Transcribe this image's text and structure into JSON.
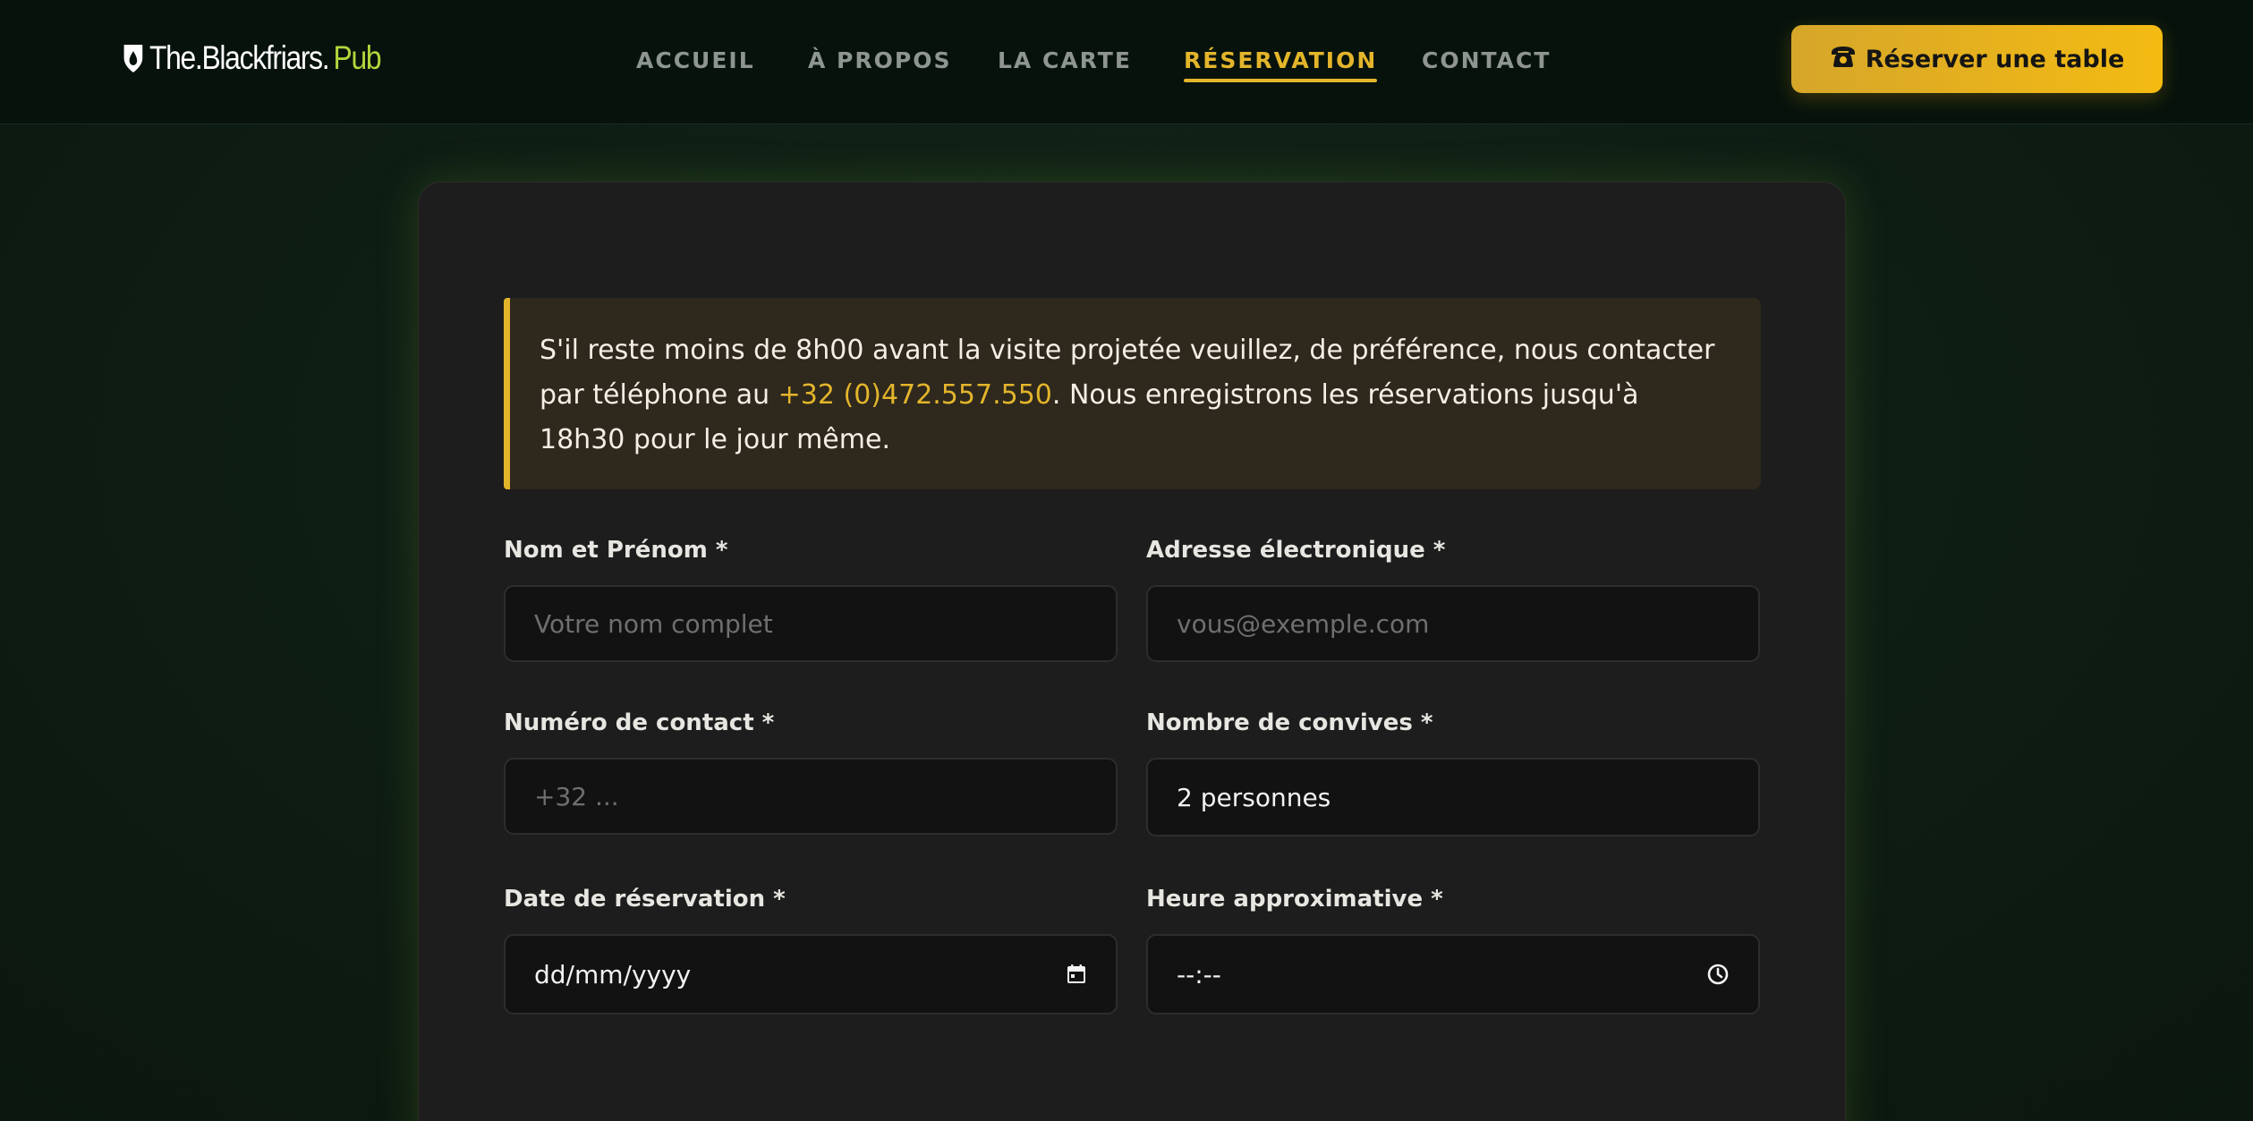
{
  "header": {
    "logo": {
      "main": "The.Blackfriars.",
      "suffix": "Pub"
    },
    "nav": [
      {
        "label": "ACCUEIL",
        "active": false
      },
      {
        "label": "À PROPOS",
        "active": false
      },
      {
        "label": "LA CARTE",
        "active": false
      },
      {
        "label": "RÉSERVATION",
        "active": true
      },
      {
        "label": "CONTACT",
        "active": false
      }
    ],
    "cta": {
      "icon": "phone-icon",
      "label": "Réserver une table"
    }
  },
  "notice": {
    "before": "S'il reste moins de 8h00 avant la visite projetée veuillez, de préférence, nous contacter par téléphone au ",
    "phone": "+32 (0)472.557.550",
    "after": ". Nous enregistrons les réservations jusqu'à 18h30 pour le jour même."
  },
  "form": {
    "name": {
      "label": "Nom et Prénom *",
      "placeholder": "Votre nom complet"
    },
    "email": {
      "label": "Adresse électronique *",
      "placeholder": "vous@exemple.com"
    },
    "phone": {
      "label": "Numéro de contact *",
      "placeholder": "+32 ..."
    },
    "guests": {
      "label": "Nombre de convives *",
      "value": "2 personnes"
    },
    "date": {
      "label": "Date de réservation *",
      "value": "dd/mm/yyyy",
      "icon": "calendar-icon"
    },
    "time": {
      "label": "Heure approximative *",
      "value": "--:--",
      "icon": "clock-icon"
    }
  },
  "colors": {
    "accent": "#e3b52b",
    "logo_suffix": "#b5d63c",
    "background": "#0e1d14",
    "card": "#1d1d1d"
  }
}
